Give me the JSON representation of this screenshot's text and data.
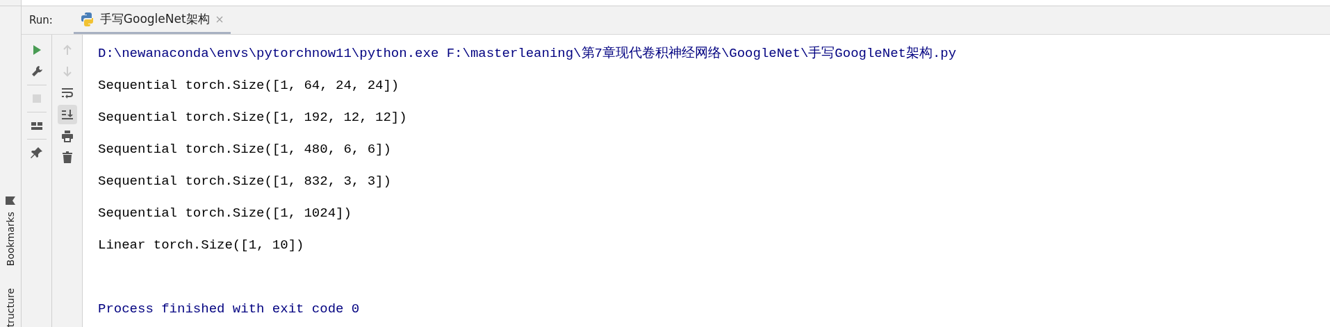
{
  "run_panel": {
    "label": "Run:",
    "tab": {
      "title": "手写GoogleNet架构",
      "selected": true
    }
  },
  "side_stripe": [
    {
      "kind": "bookmarks",
      "label": "Bookmarks"
    },
    {
      "kind": "structure",
      "label": "tructure"
    }
  ],
  "toolbar_left": [
    {
      "kind": "run",
      "disabled": false
    },
    {
      "kind": "wrench",
      "disabled": false
    },
    {
      "kind": "stop",
      "disabled": true
    },
    {
      "kind": "layout",
      "disabled": false
    },
    {
      "kind": "pin",
      "disabled": false
    }
  ],
  "toolbar_right": [
    {
      "kind": "up",
      "disabled": true,
      "selected": false
    },
    {
      "kind": "down",
      "disabled": true,
      "selected": false
    },
    {
      "kind": "wrap",
      "disabled": false,
      "selected": false
    },
    {
      "kind": "scroll-end",
      "disabled": false,
      "selected": true
    },
    {
      "kind": "print",
      "disabled": false,
      "selected": false
    },
    {
      "kind": "trash",
      "disabled": false,
      "selected": false
    }
  ],
  "console": [
    {
      "kind": "system",
      "text": "D:\\newanaconda\\envs\\pytorchnow11\\python.exe F:\\masterleaning\\第7章现代卷积神经网络\\GoogleNet\\手写GoogleNet架构.py"
    },
    {
      "kind": "output",
      "text": "Sequential torch.Size([1, 64, 24, 24])"
    },
    {
      "kind": "output",
      "text": "Sequential torch.Size([1, 192, 12, 12])"
    },
    {
      "kind": "output",
      "text": "Sequential torch.Size([1, 480, 6, 6])"
    },
    {
      "kind": "output",
      "text": "Sequential torch.Size([1, 832, 3, 3])"
    },
    {
      "kind": "output",
      "text": "Sequential torch.Size([1, 1024])"
    },
    {
      "kind": "output",
      "text": "Linear torch.Size([1, 10])"
    },
    {
      "kind": "system",
      "text": "Process finished with exit code 0"
    }
  ]
}
